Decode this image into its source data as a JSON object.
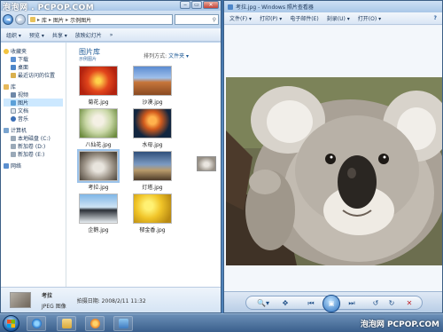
{
  "watermark": {
    "top": "泡泡网 . PCPOP.COM",
    "bottom": "泡泡网 PCPOP.COM"
  },
  "colors": {
    "accent": "#3c6ea5",
    "selection": "#cce8ff",
    "delete": "#c0262c"
  },
  "explorer": {
    "title_controls": [
      "‒",
      "▭",
      "✕"
    ],
    "breadcrumb": [
      "库",
      "图片",
      "示例图片"
    ],
    "toolbar": {
      "organize": "组织 ▾",
      "preview": "预览 ▾",
      "share": "共享 ▾",
      "slideshow": "放映幻灯片",
      "more": "»"
    },
    "nav": {
      "favorites": "收藏夹",
      "fav_items": [
        "下载",
        "桌面",
        "最近访问的位置"
      ],
      "libraries": "库",
      "lib_items": [
        "视频",
        "图片",
        "文档",
        "音乐"
      ],
      "computer": "计算机",
      "comp_items": [
        "本地磁盘 (C:)",
        "新加卷 (D:)",
        "新加卷 (E:)"
      ],
      "network": "网络"
    },
    "library": {
      "title": "图片库",
      "subtitle": "示例图片",
      "arrange_by": "排列方式:",
      "arrange_value": "文件夹 ▾"
    },
    "thumbnails": [
      "菊花.jpg",
      "沙漠.jpg",
      "八仙花.jpg",
      "水母.jpg",
      "考拉.jpg",
      "灯塔.jpg",
      "企鹅.jpg",
      "郁金香.jpg"
    ],
    "details": {
      "filename": "考拉",
      "filetype": "JPEG 图像",
      "date_taken": "拍摄日期: 2008/2/11 11:32"
    }
  },
  "viewer": {
    "title": "考拉.jpg - Windows 照片查看器",
    "menu": [
      "文件(F) ▾",
      "打印(P) ▾",
      "电子邮件(E)",
      "刻录(U) ▾",
      "打开(O) ▾"
    ],
    "controls": [
      "🔍▾",
      "✥",
      "⏮",
      "▣",
      "⏭",
      "↺",
      "↻",
      "✕"
    ]
  },
  "taskbar": {
    "items": [
      "internet-explorer",
      "windows-explorer",
      "media-player",
      "photo-viewer"
    ]
  }
}
